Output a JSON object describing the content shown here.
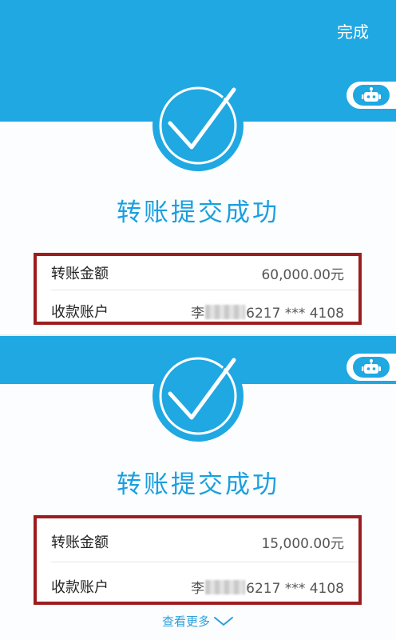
{
  "header": {
    "done_label": "完成"
  },
  "colors": {
    "brand_blue": "#1fa8e2",
    "title_blue": "#1b9fde",
    "highlight_red": "#9c1d1f"
  },
  "icons": {
    "check": "check-circle-icon",
    "assistant": "robot-icon",
    "more": "chevron-down-icon"
  },
  "panels": [
    {
      "title": "转账提交成功",
      "amount_label": "转账金额",
      "amount_value": "60,000.00元",
      "account_label": "收款账户",
      "account_name": "李",
      "account_number": "6217 *** 4108"
    },
    {
      "title": "转账提交成功",
      "amount_label": "转账金额",
      "amount_value": "15,000.00元",
      "account_label": "收款账户",
      "account_name": "李",
      "account_number": "6217 *** 4108"
    }
  ],
  "footer": {
    "see_more_label": "查看更多"
  }
}
